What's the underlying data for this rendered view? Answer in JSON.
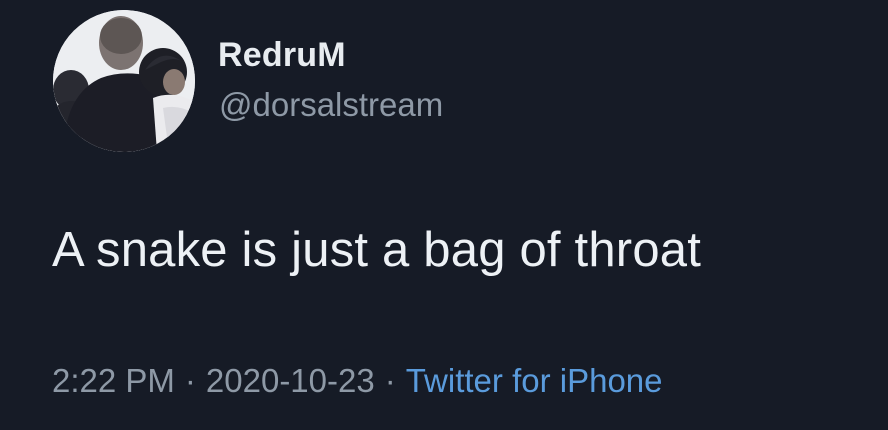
{
  "tweet": {
    "author": {
      "display_name": "RedruM",
      "handle": "@dorsalstream",
      "avatar_icon": "profile-photo"
    },
    "text": "A snake is just a bag of throat",
    "meta": {
      "time": "2:22 PM",
      "separator": "·",
      "date": "2020-10-23",
      "source": "Twitter for iPhone"
    }
  },
  "colors": {
    "background": "#161b26",
    "primary_text": "#edf1f5",
    "secondary_text": "#8e99a6",
    "link": "#5a9bdc"
  }
}
